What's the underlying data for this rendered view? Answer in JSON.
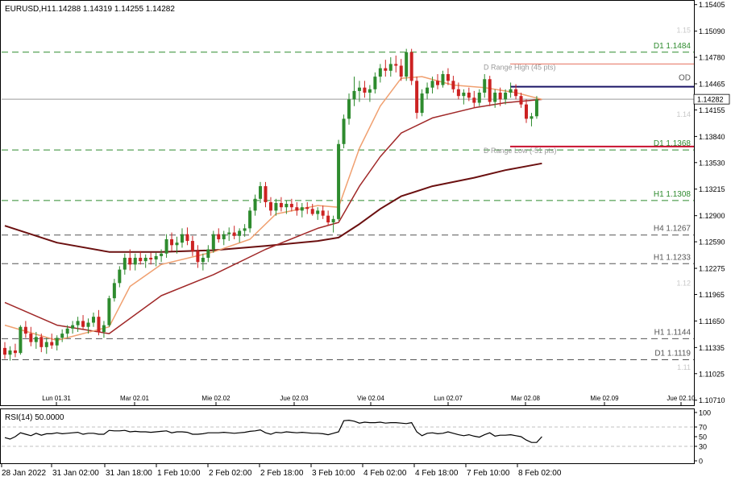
{
  "header": {
    "symbol": "EURUSD,H1",
    "ohlc": "1.14288 1.14319 1.14255 1.14282"
  },
  "colors": {
    "background": "#ffffff",
    "bull_candle": "#2e8b2e",
    "bear_candle": "#cc2222",
    "ma_fast": "#f0a070",
    "ma_mid": "#a02828",
    "ma_slow": "#6b1010",
    "d_range_high": "#e88070",
    "d_range_low": "#c8102e",
    "od_line": "#1a1466",
    "level_green": "#2e8b2e",
    "level_gray": "#555555",
    "price_label_bg": "#ffffff",
    "rsi_line": "#000000"
  },
  "chart_data": [
    {
      "type": "candlestick",
      "title": "EURUSD,H1",
      "ylim": [
        1.1065,
        1.1545
      ],
      "y_ticks": [
        "1.15405",
        "1.15090",
        "1.14780",
        "1.14465",
        "1.14155",
        "1.13840",
        "1.13530",
        "1.13215",
        "1.12900",
        "1.12590",
        "1.12275",
        "1.11965",
        "1.11650",
        "1.11335",
        "1.11025",
        "1.10710"
      ],
      "x_ticks_top": [
        "Lun 01.31",
        "Mar 02.01",
        "Mie 02.02",
        "Jue 02.03",
        "Vie 02.04",
        "Lun 02.07",
        "Mar 02.08",
        "Mie 02.09",
        "Jue 02.10"
      ],
      "x_ticks_bottom": [
        "28 Jan 2022",
        "31 Jan 02:00",
        "31 Jan 18:00",
        "1 Feb 10:00",
        "2 Feb 02:00",
        "2 Feb 18:00",
        "3 Feb 10:00",
        "4 Feb 02:00",
        "4 Feb 18:00",
        "7 Feb 10:00",
        "8 Feb 02:00"
      ],
      "current_price": "1.14282",
      "levels": [
        {
          "label": "D1 1.1484",
          "value": 1.1484,
          "style": "dashed",
          "color": "green"
        },
        {
          "label": "OD",
          "value": 1.1443,
          "style": "solid",
          "color": "navy"
        },
        {
          "label": "D1 1.1368",
          "value": 1.1368,
          "style": "dashed",
          "color": "green"
        },
        {
          "label": "H1 1.1308",
          "value": 1.1308,
          "style": "dashed",
          "color": "green"
        },
        {
          "label": "H4 1.1267",
          "value": 1.1267,
          "style": "dashed",
          "color": "gray"
        },
        {
          "label": "H1 1.1233",
          "value": 1.1233,
          "style": "dashed",
          "color": "gray"
        },
        {
          "label": "H1 1.1144",
          "value": 1.1144,
          "style": "dashed",
          "color": "gray"
        },
        {
          "label": "D1 1.1119",
          "value": 1.1119,
          "style": "dashed",
          "color": "gray"
        }
      ],
      "range_lines": [
        {
          "label": "D Range High (45 pts)",
          "value": 1.147
        },
        {
          "label": "D Range Low (-51 pts)",
          "value": 1.1372
        }
      ],
      "faint_labels": [
        {
          "text": "1.15",
          "value": 1.151
        },
        {
          "text": "1.14",
          "value": 1.141
        },
        {
          "text": "1.12",
          "value": 1.121
        },
        {
          "text": "1.11",
          "value": 1.111
        }
      ],
      "candles": [
        [
          1.1133,
          1.114,
          1.112,
          1.1125
        ],
        [
          1.1125,
          1.1135,
          1.1118,
          1.113
        ],
        [
          1.113,
          1.1138,
          1.1122,
          1.1127
        ],
        [
          1.1127,
          1.116,
          1.1125,
          1.1158
        ],
        [
          1.1158,
          1.1165,
          1.1145,
          1.115
        ],
        [
          1.115,
          1.1158,
          1.1135,
          1.114
        ],
        [
          1.114,
          1.1152,
          1.1132,
          1.1146
        ],
        [
          1.1146,
          1.115,
          1.1128,
          1.1134
        ],
        [
          1.1134,
          1.1145,
          1.1126,
          1.114
        ],
        [
          1.114,
          1.115,
          1.1132,
          1.1136
        ],
        [
          1.1136,
          1.1148,
          1.113,
          1.1145
        ],
        [
          1.1145,
          1.1155,
          1.114,
          1.115
        ],
        [
          1.115,
          1.116,
          1.1145,
          1.1156
        ],
        [
          1.1156,
          1.1165,
          1.115,
          1.116
        ],
        [
          1.116,
          1.117,
          1.1152,
          1.1165
        ],
        [
          1.1165,
          1.1172,
          1.1155,
          1.1158
        ],
        [
          1.1158,
          1.1168,
          1.115,
          1.1163
        ],
        [
          1.1163,
          1.1175,
          1.1158,
          1.117
        ],
        [
          1.117,
          1.1178,
          1.1148,
          1.1152
        ],
        [
          1.1152,
          1.1165,
          1.1145,
          1.116
        ],
        [
          1.116,
          1.1195,
          1.1158,
          1.1192
        ],
        [
          1.1192,
          1.1215,
          1.1188,
          1.121
        ],
        [
          1.121,
          1.123,
          1.1205,
          1.1226
        ],
        [
          1.1226,
          1.1245,
          1.122,
          1.124
        ],
        [
          1.124,
          1.125,
          1.1225,
          1.1232
        ],
        [
          1.1232,
          1.1245,
          1.1225,
          1.124
        ],
        [
          1.124,
          1.1248,
          1.1232,
          1.1236
        ],
        [
          1.1236,
          1.1244,
          1.1228,
          1.124
        ],
        [
          1.124,
          1.1246,
          1.1232,
          1.1238
        ],
        [
          1.1238,
          1.1246,
          1.123,
          1.1242
        ],
        [
          1.1242,
          1.125,
          1.1235,
          1.1245
        ],
        [
          1.1245,
          1.1268,
          1.124,
          1.1262
        ],
        [
          1.1262,
          1.127,
          1.1248,
          1.1255
        ],
        [
          1.1255,
          1.1265,
          1.1245,
          1.1258
        ],
        [
          1.1258,
          1.1275,
          1.1252,
          1.1268
        ],
        [
          1.1268,
          1.1276,
          1.1255,
          1.126
        ],
        [
          1.126,
          1.1266,
          1.1242,
          1.1248
        ],
        [
          1.1248,
          1.1255,
          1.1228,
          1.1235
        ],
        [
          1.1235,
          1.1245,
          1.1225,
          1.124
        ],
        [
          1.124,
          1.1255,
          1.1235,
          1.125
        ],
        [
          1.125,
          1.1272,
          1.1246,
          1.1268
        ],
        [
          1.1268,
          1.1275,
          1.1258,
          1.1262
        ],
        [
          1.1262,
          1.1272,
          1.1255,
          1.1268
        ],
        [
          1.1268,
          1.1276,
          1.126,
          1.127
        ],
        [
          1.127,
          1.1278,
          1.1262,
          1.1266
        ],
        [
          1.1266,
          1.1275,
          1.1258,
          1.1272
        ],
        [
          1.1272,
          1.128,
          1.1265,
          1.1275
        ],
        [
          1.1275,
          1.13,
          1.127,
          1.1296
        ],
        [
          1.1296,
          1.1315,
          1.129,
          1.131
        ],
        [
          1.131,
          1.133,
          1.1305,
          1.1325
        ],
        [
          1.1325,
          1.133,
          1.13,
          1.1306
        ],
        [
          1.1306,
          1.1312,
          1.129,
          1.1296
        ],
        [
          1.1296,
          1.131,
          1.129,
          1.1305
        ],
        [
          1.1305,
          1.1312,
          1.1295,
          1.13
        ],
        [
          1.13,
          1.1308,
          1.1292,
          1.1304
        ],
        [
          1.1304,
          1.131,
          1.1295,
          1.13
        ],
        [
          1.13,
          1.1306,
          1.129,
          1.1296
        ],
        [
          1.1296,
          1.1305,
          1.1288,
          1.13
        ],
        [
          1.13,
          1.1306,
          1.1292,
          1.1298
        ],
        [
          1.1298,
          1.1304,
          1.129,
          1.1292
        ],
        [
          1.1292,
          1.13,
          1.1285,
          1.1296
        ],
        [
          1.1296,
          1.1302,
          1.1286,
          1.129
        ],
        [
          1.129,
          1.1296,
          1.1278,
          1.1282
        ],
        [
          1.1282,
          1.129,
          1.127,
          1.1286
        ],
        [
          1.1286,
          1.138,
          1.1284,
          1.1375
        ],
        [
          1.1375,
          1.141,
          1.137,
          1.1405
        ],
        [
          1.1405,
          1.1435,
          1.1398,
          1.1428
        ],
        [
          1.1428,
          1.1455,
          1.142,
          1.1438
        ],
        [
          1.1438,
          1.145,
          1.1425,
          1.1442
        ],
        [
          1.1442,
          1.145,
          1.143,
          1.1436
        ],
        [
          1.1436,
          1.1445,
          1.1425,
          1.144
        ],
        [
          1.144,
          1.146,
          1.1435,
          1.1455
        ],
        [
          1.1455,
          1.147,
          1.1448,
          1.1465
        ],
        [
          1.1465,
          1.1475,
          1.1455,
          1.1462
        ],
        [
          1.1462,
          1.1478,
          1.1455,
          1.147
        ],
        [
          1.147,
          1.148,
          1.146,
          1.1468
        ],
        [
          1.1468,
          1.1476,
          1.145,
          1.1455
        ],
        [
          1.1455,
          1.1488,
          1.145,
          1.1484
        ],
        [
          1.1484,
          1.1488,
          1.1445,
          1.145
        ],
        [
          1.145,
          1.1455,
          1.1405,
          1.1412
        ],
        [
          1.1412,
          1.144,
          1.1408,
          1.1435
        ],
        [
          1.1435,
          1.1448,
          1.1428,
          1.1442
        ],
        [
          1.1442,
          1.1455,
          1.1435,
          1.145
        ],
        [
          1.145,
          1.1458,
          1.144,
          1.1445
        ],
        [
          1.1445,
          1.1462,
          1.1442,
          1.1458
        ],
        [
          1.1458,
          1.1465,
          1.1445,
          1.145
        ],
        [
          1.145,
          1.1456,
          1.1436,
          1.144
        ],
        [
          1.144,
          1.1448,
          1.1428,
          1.1432
        ],
        [
          1.1432,
          1.144,
          1.1422,
          1.1436
        ],
        [
          1.1436,
          1.1442,
          1.1426,
          1.143
        ],
        [
          1.143,
          1.1438,
          1.1418,
          1.1424
        ],
        [
          1.1424,
          1.144,
          1.142,
          1.1436
        ],
        [
          1.1436,
          1.1458,
          1.143,
          1.1452
        ],
        [
          1.1452,
          1.1456,
          1.142,
          1.1425
        ],
        [
          1.1425,
          1.144,
          1.1418,
          1.1436
        ],
        [
          1.1436,
          1.1442,
          1.142,
          1.1428
        ],
        [
          1.1428,
          1.144,
          1.1422,
          1.1436
        ],
        [
          1.1436,
          1.1448,
          1.143,
          1.144
        ],
        [
          1.144,
          1.1446,
          1.1428,
          1.1432
        ],
        [
          1.1432,
          1.1436,
          1.1418,
          1.1422
        ],
        [
          1.1422,
          1.1428,
          1.14,
          1.1405
        ],
        [
          1.1405,
          1.1412,
          1.1396,
          1.1408
        ],
        [
          1.1408,
          1.1432,
          1.1405,
          1.1428
        ]
      ],
      "ma_fast_points": [
        [
          0,
          1.116
        ],
        [
          10,
          1.1142
        ],
        [
          20,
          1.1158
        ],
        [
          24,
          1.1206
        ],
        [
          30,
          1.1232
        ],
        [
          40,
          1.1247
        ],
        [
          47,
          1.1262
        ],
        [
          52,
          1.1292
        ],
        [
          60,
          1.1302
        ],
        [
          64,
          1.13
        ],
        [
          68,
          1.137
        ],
        [
          72,
          1.142
        ],
        [
          76,
          1.1453
        ],
        [
          80,
          1.1455
        ],
        [
          86,
          1.1445
        ],
        [
          92,
          1.1442
        ],
        [
          98,
          1.1436
        ],
        [
          103,
          1.1428
        ]
      ],
      "ma_mid_points": [
        [
          0,
          1.1187
        ],
        [
          10,
          1.116
        ],
        [
          20,
          1.115
        ],
        [
          30,
          1.1195
        ],
        [
          40,
          1.122
        ],
        [
          50,
          1.125
        ],
        [
          60,
          1.1275
        ],
        [
          64,
          1.1282
        ],
        [
          68,
          1.1325
        ],
        [
          72,
          1.136
        ],
        [
          76,
          1.1388
        ],
        [
          82,
          1.1406
        ],
        [
          90,
          1.1418
        ],
        [
          96,
          1.1424
        ],
        [
          103,
          1.1428
        ]
      ],
      "ma_slow_points": [
        [
          0,
          1.1278
        ],
        [
          10,
          1.1258
        ],
        [
          20,
          1.1247
        ],
        [
          30,
          1.1247
        ],
        [
          40,
          1.1249
        ],
        [
          50,
          1.1254
        ],
        [
          60,
          1.126
        ],
        [
          64,
          1.1264
        ],
        [
          68,
          1.128
        ],
        [
          72,
          1.1298
        ],
        [
          76,
          1.1313
        ],
        [
          82,
          1.1325
        ],
        [
          90,
          1.1335
        ],
        [
          96,
          1.1344
        ],
        [
          103,
          1.1352
        ]
      ]
    },
    {
      "type": "line",
      "title": "RSI(14) 50.0000",
      "ylim": [
        0,
        100
      ],
      "y_ticks": [
        "100",
        "70",
        "50",
        "30",
        "0"
      ],
      "values": [
        48,
        45,
        50,
        58,
        55,
        52,
        57,
        53,
        56,
        56,
        58,
        56,
        57,
        58,
        59,
        55,
        57,
        57,
        55,
        55,
        63,
        62,
        62,
        63,
        60,
        61,
        60,
        60,
        59,
        60,
        61,
        62,
        58,
        60,
        60,
        59,
        55,
        55,
        56,
        58,
        58,
        58,
        59,
        58,
        57,
        58,
        59,
        61,
        62,
        64,
        58,
        55,
        59,
        58,
        60,
        59,
        58,
        59,
        58,
        57,
        57,
        56,
        54,
        57,
        60,
        83,
        84,
        82,
        78,
        80,
        79,
        79,
        80,
        78,
        79,
        79,
        78,
        77,
        79,
        60,
        52,
        57,
        58,
        56,
        57,
        60,
        57,
        54,
        52,
        54,
        51,
        49,
        54,
        58,
        51,
        53,
        53,
        54,
        52,
        50,
        43,
        38,
        38,
        50
      ]
    }
  ]
}
